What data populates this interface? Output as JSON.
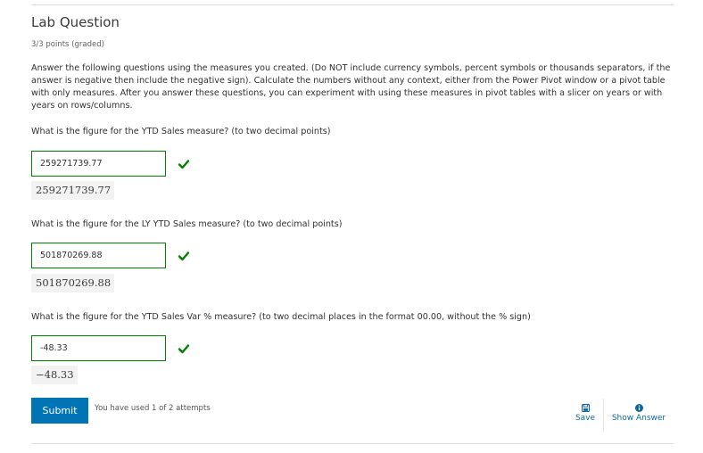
{
  "problem": {
    "title": "Lab Question",
    "points": "3/3 points (graded)",
    "instructions": "Answer the following questions using the measures you created. (Do NOT include currency symbols, percent symbols or thousands separators, if the answer is negative then include the negative sign). Calculate the numbers without any context, either from the Power Pivot window or a pivot table with only measures. After you answer these questions, you can experiment with using these measures in pivot tables with a slicer on years or with years on rows/columns."
  },
  "questions": [
    {
      "prompt": "What is the figure for the YTD Sales measure? (to two decimal points)",
      "input_value": "259271739.77",
      "submitted_display": "259271739.77",
      "status": "correct"
    },
    {
      "prompt": "What is the figure for the LY YTD Sales measure? (to two decimal points)",
      "input_value": "501870269.88",
      "submitted_display": "501870269.88",
      "status": "correct"
    },
    {
      "prompt": "What is the figure for the YTD Sales Var % measure? (to two decimal places in the format 00.00, without the % sign)",
      "input_value": "-48.33",
      "submitted_display": "−48.33",
      "status": "correct"
    }
  ],
  "actions": {
    "submit_label": "Submit",
    "attempts_text": "You have used 1 of 2 attempts",
    "save_label": "Save",
    "save_icon": "floppy-disk-icon",
    "show_answer_label": "Show Answer",
    "show_answer_icon": "info-circle-icon"
  },
  "colors": {
    "correct": "#008100",
    "primary_button": "#0074b5",
    "link": "#0b66a6"
  }
}
